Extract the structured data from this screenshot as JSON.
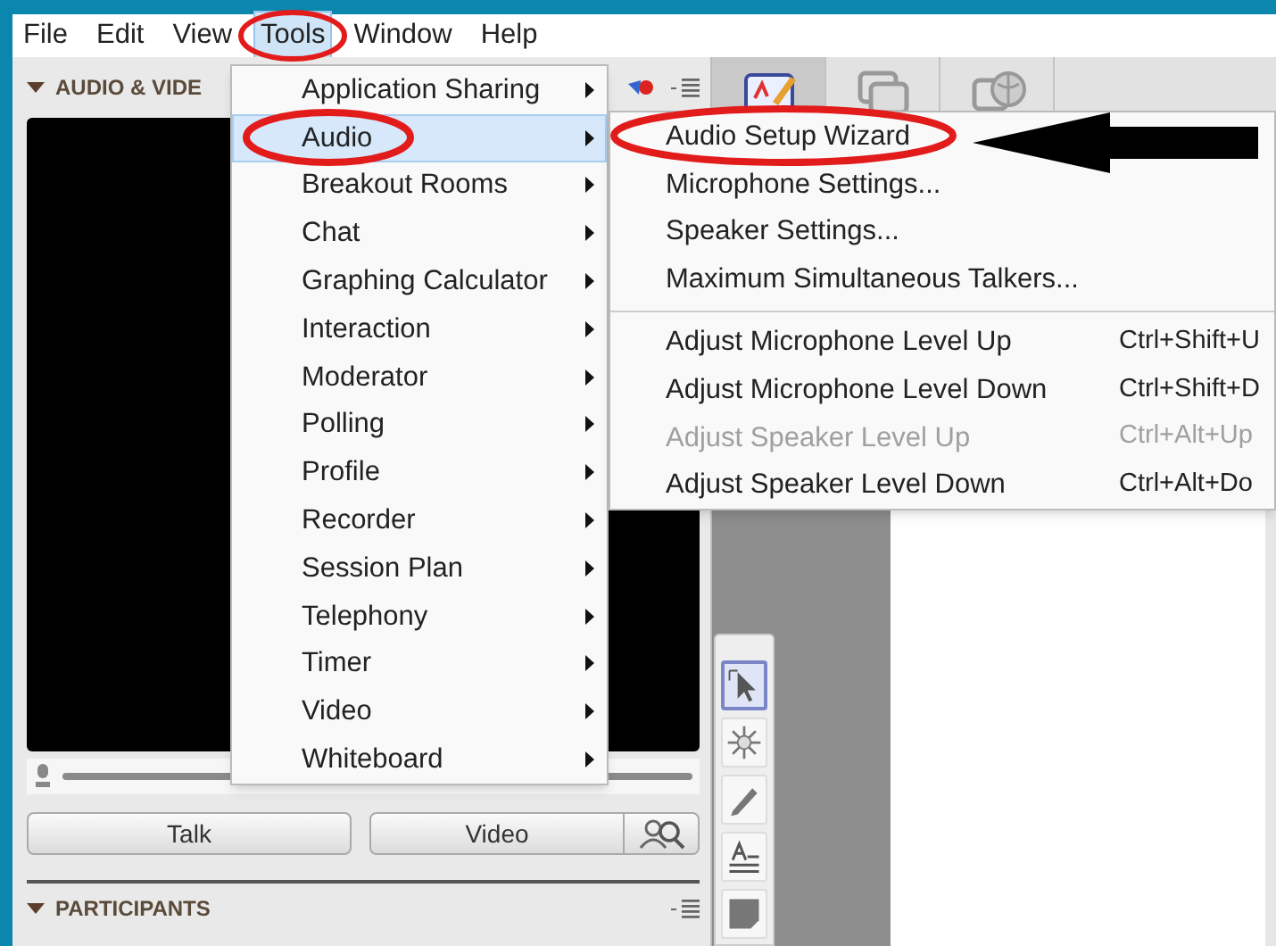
{
  "menu_bar": [
    {
      "label": "File",
      "selected": false
    },
    {
      "label": "Edit",
      "selected": false
    },
    {
      "label": "View",
      "selected": false
    },
    {
      "label": "Tools",
      "selected": true
    },
    {
      "label": "Window",
      "selected": false
    },
    {
      "label": "Help",
      "selected": false
    }
  ],
  "audio_video_panel": {
    "title": "AUDIO & VIDE",
    "buttons": [
      "Talk",
      "Video"
    ]
  },
  "participants_panel": {
    "title": "PARTICIPANTS"
  },
  "content_tabs": [
    {
      "kind": "whiteboard",
      "selected": true
    },
    {
      "kind": "windows",
      "selected": false
    },
    {
      "kind": "web",
      "selected": false
    }
  ],
  "whiteboard_tools": [
    {
      "kind": "select",
      "selected": true
    },
    {
      "kind": "pointer",
      "selected": false
    },
    {
      "kind": "pencil",
      "selected": false
    },
    {
      "kind": "text",
      "selected": false
    },
    {
      "kind": "shape",
      "selected": false
    }
  ],
  "tools_menu": {
    "items": [
      {
        "label": "Application Sharing",
        "selected": false
      },
      {
        "label": "Audio",
        "selected": true
      },
      {
        "label": "Breakout Rooms",
        "selected": false
      },
      {
        "label": "Chat",
        "selected": false
      },
      {
        "label": "Graphing Calculator",
        "selected": false
      },
      {
        "label": "Interaction",
        "selected": false
      },
      {
        "label": "Moderator",
        "selected": false
      },
      {
        "label": "Polling",
        "selected": false
      },
      {
        "label": "Profile",
        "selected": false
      },
      {
        "label": "Recorder",
        "selected": false
      },
      {
        "label": "Session Plan",
        "selected": false
      },
      {
        "label": "Telephony",
        "selected": false
      },
      {
        "label": "Timer",
        "selected": false
      },
      {
        "label": "Video",
        "selected": false
      },
      {
        "label": "Whiteboard",
        "selected": false
      }
    ]
  },
  "audio_submenu": {
    "sections": [
      [
        {
          "label": "Audio Setup Wizard",
          "disabled": false
        },
        {
          "label": "Microphone Settings...",
          "disabled": false
        },
        {
          "label": "Speaker Settings...",
          "disabled": false
        },
        {
          "label": "Maximum Simultaneous Talkers...",
          "disabled": false
        }
      ],
      [
        {
          "label": "Adjust Microphone Level Up",
          "shortcut": "Ctrl+Shift+U",
          "disabled": false
        },
        {
          "label": "Adjust Microphone Level Down",
          "shortcut": "Ctrl+Shift+D",
          "disabled": false
        },
        {
          "label": "Adjust Speaker Level Up",
          "shortcut": "Ctrl+Alt+Up",
          "disabled": true
        },
        {
          "label": "Adjust Speaker Level Down",
          "shortcut": "Ctrl+Alt+Do",
          "disabled": false
        }
      ]
    ]
  }
}
